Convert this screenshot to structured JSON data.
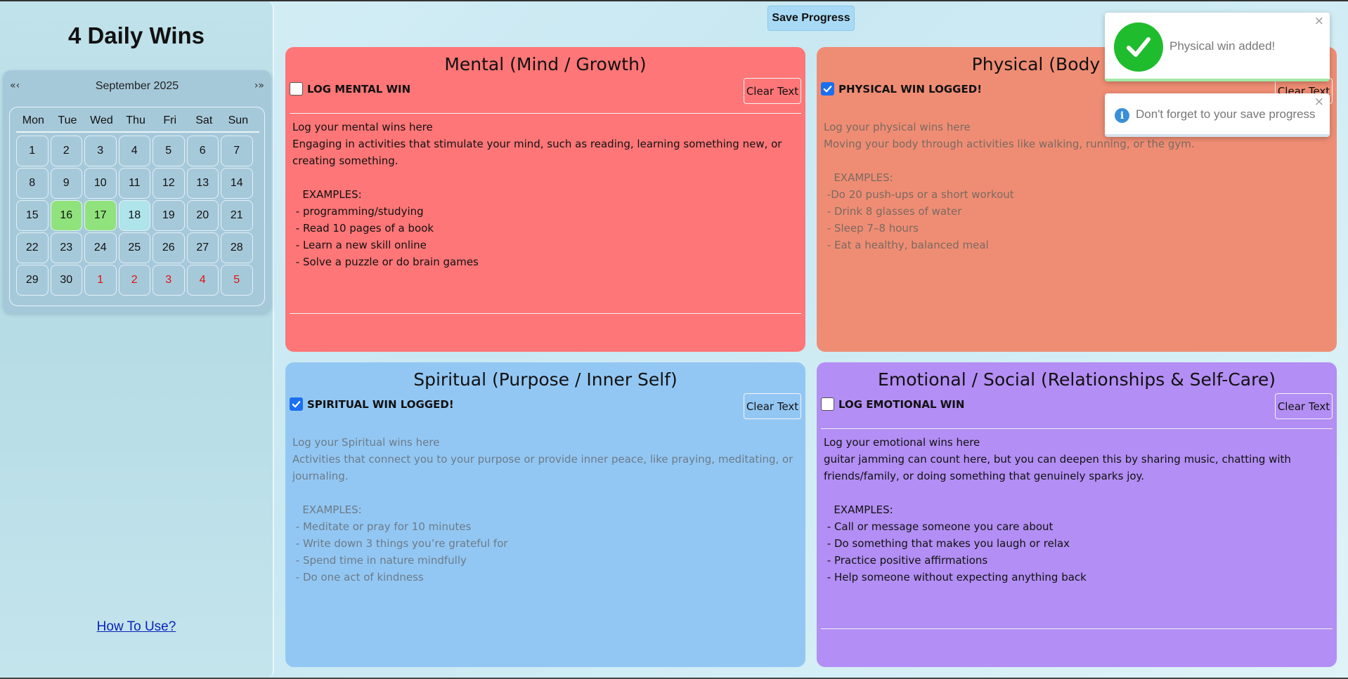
{
  "sidebar": {
    "title": "4 Daily Wins",
    "how_to": "How To Use?"
  },
  "calendar": {
    "prev": "«‹",
    "next": "›»",
    "month": "September 2025",
    "weekdays": [
      "Mon",
      "Tue",
      "Wed",
      "Thu",
      "Fri",
      "Sat",
      "Sun"
    ],
    "days": [
      {
        "label": "1",
        "state": "normal"
      },
      {
        "label": "2",
        "state": "normal"
      },
      {
        "label": "3",
        "state": "normal"
      },
      {
        "label": "4",
        "state": "normal"
      },
      {
        "label": "5",
        "state": "normal"
      },
      {
        "label": "6",
        "state": "normal"
      },
      {
        "label": "7",
        "state": "normal"
      },
      {
        "label": "8",
        "state": "normal"
      },
      {
        "label": "9",
        "state": "normal"
      },
      {
        "label": "10",
        "state": "normal"
      },
      {
        "label": "11",
        "state": "normal"
      },
      {
        "label": "12",
        "state": "normal"
      },
      {
        "label": "13",
        "state": "normal"
      },
      {
        "label": "14",
        "state": "normal"
      },
      {
        "label": "15",
        "state": "normal"
      },
      {
        "label": "16",
        "state": "done"
      },
      {
        "label": "17",
        "state": "done"
      },
      {
        "label": "18",
        "state": "today"
      },
      {
        "label": "19",
        "state": "normal"
      },
      {
        "label": "20",
        "state": "normal"
      },
      {
        "label": "21",
        "state": "normal"
      },
      {
        "label": "22",
        "state": "normal"
      },
      {
        "label": "23",
        "state": "normal"
      },
      {
        "label": "24",
        "state": "normal"
      },
      {
        "label": "25",
        "state": "normal"
      },
      {
        "label": "26",
        "state": "normal"
      },
      {
        "label": "27",
        "state": "normal"
      },
      {
        "label": "28",
        "state": "normal"
      },
      {
        "label": "29",
        "state": "normal"
      },
      {
        "label": "30",
        "state": "normal"
      },
      {
        "label": "1",
        "state": "other"
      },
      {
        "label": "2",
        "state": "other"
      },
      {
        "label": "3",
        "state": "other"
      },
      {
        "label": "4",
        "state": "other"
      },
      {
        "label": "5",
        "state": "other"
      }
    ],
    "colors": {
      "done": "#90e37c",
      "today": "#aee4ea",
      "other_month_text": "#e01010"
    }
  },
  "header": {
    "save_label": "Save Progress"
  },
  "cards": {
    "mental": {
      "title": "Mental (Mind / Growth)",
      "checked": false,
      "check_label": "LOG MENTAL WIN",
      "clear_label": "Clear Text",
      "text": "Log your mental wins here\nEngaging in activities that stimulate your mind, such as reading, learning something new, or creating something.\n\n   EXAMPLES:\n - programming/studying\n - Read 10 pages of a book\n - Learn a new skill online\n - Solve a puzzle or do brain games",
      "color": "#fe7677"
    },
    "physical": {
      "title": "Physical (Body / Health)",
      "checked": true,
      "check_label": "PHYSICAL WIN LOGGED!",
      "clear_label": "Clear Text",
      "text": "Log your physical wins here\nMoving your body through activities like walking, running, or the gym.\n\n   EXAMPLES:\n -Do 20 push-ups or a short workout\n - Drink 8 glasses of water\n - Sleep 7–8 hours\n - Eat a healthy, balanced meal",
      "color": "#ef8d74"
    },
    "spiritual": {
      "title": "Spiritual (Purpose / Inner Self)",
      "checked": true,
      "check_label": "SPIRITUAL WIN LOGGED!",
      "clear_label": "Clear Text",
      "text": "Log your Spiritual wins here\nActivities that connect you to your purpose or provide inner peace, like praying, meditating, or journaling.\n\n   EXAMPLES:\n - Meditate or pray for 10 minutes\n - Write down 3 things you’re grateful for\n - Spend time in nature mindfully\n - Do one act of kindness",
      "color": "#93c7f3"
    },
    "emotional": {
      "title": "Emotional / Social (Relationships & Self-Care)",
      "checked": false,
      "check_label": "LOG EMOTIONAL WIN",
      "clear_label": "Clear Text",
      "text": "Log your emotional wins here\nguitar jamming can count here, but you can deepen this by sharing music, chatting with friends/family, or doing something that genuinely sparks joy.\n\n   EXAMPLES:\n - Call or message someone you care about\n - Do something that makes you laugh or relax\n - Practice positive affirmations\n - Help someone without expecting anything back",
      "color": "#b38ef4"
    }
  },
  "toasts": {
    "success": {
      "message": "Physical win added!",
      "close": "×",
      "icon": "checkmark-icon"
    },
    "info": {
      "message": "Don't forget to your save progress",
      "close": "×",
      "icon": "info-icon",
      "glyph": "i"
    }
  }
}
